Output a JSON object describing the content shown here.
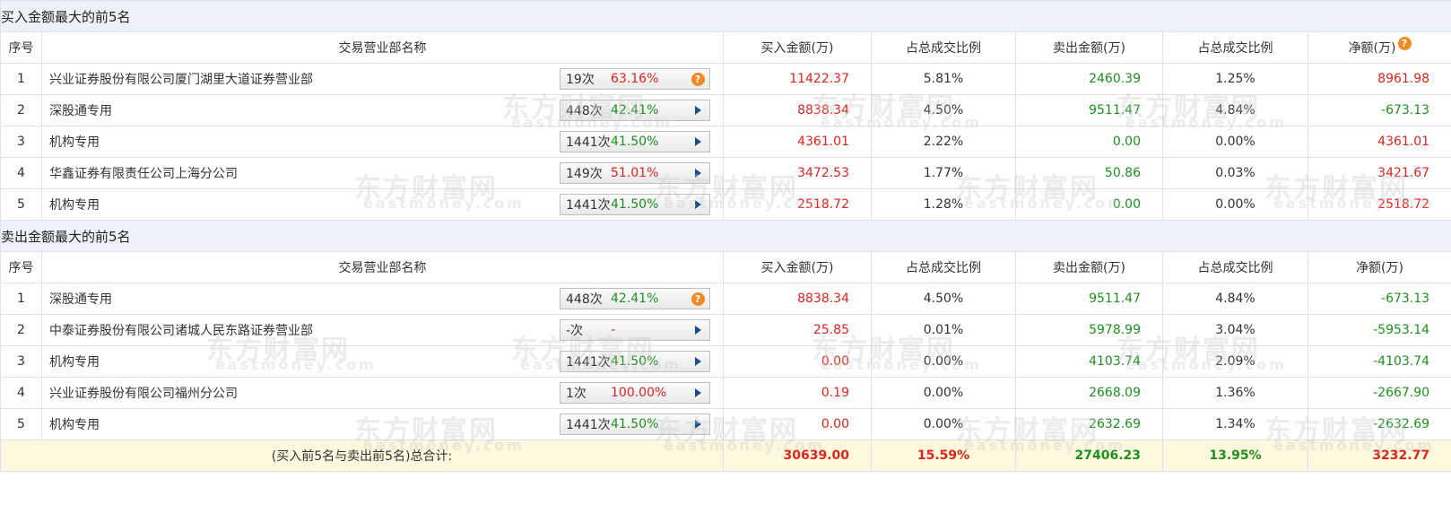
{
  "watermark": {
    "cn": "东方财富网",
    "en": "eastmoney.com"
  },
  "buy_section": {
    "title": "买入金额最大的前5名",
    "headers": {
      "no": "序号",
      "name": "交易营业部名称",
      "buy": "买入金额(万)",
      "buy_pct": "占总成交比例",
      "sell": "卖出金额(万)",
      "sell_pct": "占总成交比例",
      "net": "净额(万)"
    },
    "rows": [
      {
        "no": "1",
        "name": "兴业证券股份有限公司厦门湖里大道证券营业部",
        "count": "19次",
        "rate": "63.16%",
        "rate_color": "red",
        "icon": "question-icon",
        "buy": "11422.37",
        "buy_pct": "5.81%",
        "sell": "2460.39",
        "sell_pct": "1.25%",
        "net": "8961.98",
        "net_color": "red"
      },
      {
        "no": "2",
        "name": "深股通专用",
        "count": "448次",
        "rate": "42.41%",
        "rate_color": "green",
        "icon": "arrow-right-icon",
        "buy": "8838.34",
        "buy_pct": "4.50%",
        "sell": "9511.47",
        "sell_pct": "4.84%",
        "net": "-673.13",
        "net_color": "green"
      },
      {
        "no": "3",
        "name": "机构专用",
        "count": "1441次",
        "rate": "41.50%",
        "rate_color": "green",
        "icon": "arrow-right-icon",
        "buy": "4361.01",
        "buy_pct": "2.22%",
        "sell": "0.00",
        "sell_pct": "0.00%",
        "net": "4361.01",
        "net_color": "red"
      },
      {
        "no": "4",
        "name": "华鑫证券有限责任公司上海分公司",
        "count": "149次",
        "rate": "51.01%",
        "rate_color": "red",
        "icon": "arrow-right-icon",
        "buy": "3472.53",
        "buy_pct": "1.77%",
        "sell": "50.86",
        "sell_pct": "0.03%",
        "net": "3421.67",
        "net_color": "red"
      },
      {
        "no": "5",
        "name": "机构专用",
        "count": "1441次",
        "rate": "41.50%",
        "rate_color": "green",
        "icon": "arrow-right-icon",
        "buy": "2518.72",
        "buy_pct": "1.28%",
        "sell": "0.00",
        "sell_pct": "0.00%",
        "net": "2518.72",
        "net_color": "red"
      }
    ]
  },
  "sell_section": {
    "title": "卖出金额最大的前5名",
    "headers": {
      "no": "序号",
      "name": "交易营业部名称",
      "buy": "买入金额(万)",
      "buy_pct": "占总成交比例",
      "sell": "卖出金额(万)",
      "sell_pct": "占总成交比例",
      "net": "净额(万)"
    },
    "rows": [
      {
        "no": "1",
        "name": "深股通专用",
        "count": "448次",
        "rate": "42.41%",
        "rate_color": "green",
        "icon": "question-icon",
        "buy": "8838.34",
        "buy_pct": "4.50%",
        "sell": "9511.47",
        "sell_pct": "4.84%",
        "net": "-673.13",
        "net_color": "green"
      },
      {
        "no": "2",
        "name": "中泰证券股份有限公司诸城人民东路证券营业部",
        "count": "-次",
        "rate": "-",
        "rate_color": "red",
        "icon": "arrow-right-icon",
        "buy": "25.85",
        "buy_pct": "0.01%",
        "sell": "5978.99",
        "sell_pct": "3.04%",
        "net": "-5953.14",
        "net_color": "green"
      },
      {
        "no": "3",
        "name": "机构专用",
        "count": "1441次",
        "rate": "41.50%",
        "rate_color": "green",
        "icon": "arrow-right-icon",
        "buy": "0.00",
        "buy_pct": "0.00%",
        "sell": "4103.74",
        "sell_pct": "2.09%",
        "net": "-4103.74",
        "net_color": "green"
      },
      {
        "no": "4",
        "name": "兴业证券股份有限公司福州分公司",
        "count": "1次",
        "rate": "100.00%",
        "rate_color": "red",
        "icon": "arrow-right-icon",
        "buy": "0.19",
        "buy_pct": "0.00%",
        "sell": "2668.09",
        "sell_pct": "1.36%",
        "net": "-2667.90",
        "net_color": "green"
      },
      {
        "no": "5",
        "name": "机构专用",
        "count": "1441次",
        "rate": "41.50%",
        "rate_color": "green",
        "icon": "arrow-right-icon",
        "buy": "0.00",
        "buy_pct": "0.00%",
        "sell": "2632.69",
        "sell_pct": "1.34%",
        "net": "-2632.69",
        "net_color": "green"
      }
    ]
  },
  "total": {
    "label": "(买入前5名与卖出前5名)总合计:",
    "buy": "30639.00",
    "buy_pct": "15.59%",
    "sell": "27406.23",
    "sell_pct": "13.95%",
    "net": "3232.77"
  },
  "colors": {
    "red": "#d9261f",
    "green": "#1f8f1f",
    "header_bg": "#edf2f9",
    "total_bg": "#fdf8de",
    "icon_orange": "#f08a24",
    "arrow_blue": "#1b4f8a"
  }
}
